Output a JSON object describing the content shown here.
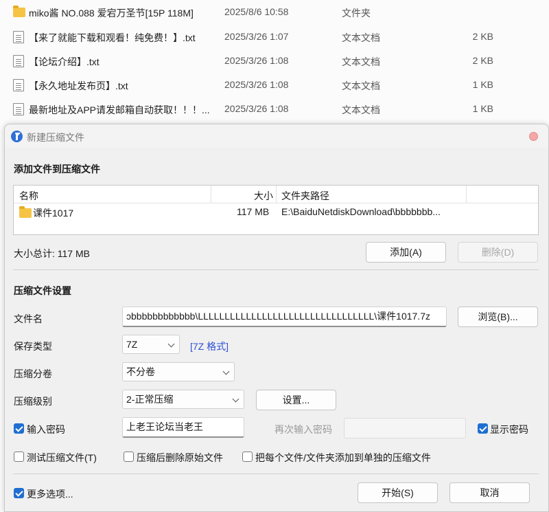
{
  "explorer": {
    "rows": [
      {
        "icon": "folder-icon",
        "name": "miko酱 NO.088 爱宕万圣节[15P 118M]",
        "date": "2025/8/6 10:58",
        "type": "文件夹",
        "size": ""
      },
      {
        "icon": "text-file-icon",
        "name": "【来了就能下载和观看！纯免费！】.txt",
        "date": "2025/3/26 1:07",
        "type": "文本文档",
        "size": "2 KB"
      },
      {
        "icon": "text-file-icon",
        "name": "【论坛介绍】.txt",
        "date": "2025/3/26 1:08",
        "type": "文本文档",
        "size": "2 KB"
      },
      {
        "icon": "text-file-icon",
        "name": "【永久地址发布页】.txt",
        "date": "2025/3/26 1:08",
        "type": "文本文档",
        "size": "1 KB"
      },
      {
        "icon": "text-file-icon",
        "name": "最新地址及APP请发邮箱自动获取！！！...",
        "date": "2025/3/26 1:08",
        "type": "文本文档",
        "size": "1 KB"
      }
    ]
  },
  "dialog": {
    "title": "新建压缩文件",
    "add_section_title": "添加文件到压缩文件",
    "file_list": {
      "headers": {
        "name": "名称",
        "size": "大小",
        "path": "文件夹路径"
      },
      "rows": [
        {
          "name": "课件1017",
          "size": "117 MB",
          "path": "E:\\BaiduNetdiskDownload\\bbbbbbb..."
        }
      ]
    },
    "total_size": "大小总计: 117 MB",
    "add_button": "添加(A)",
    "delete_button": "删除(D)",
    "settings_section_title": "压缩文件设置",
    "filename_label": "文件名",
    "filename_value": "ɔbbbbbbbbbbbb\\LLLLLLLLLLLLLLLLLLLLLLLLLLLLLLLLL\\课件1017.7z",
    "browse_button": "浏览(B)...",
    "save_type_label": "保存类型",
    "save_type_value": "7Z",
    "format_link": "[7Z 格式]",
    "split_label": "压缩分卷",
    "split_value": "不分卷",
    "level_label": "压缩级别",
    "level_value": "2-正常压缩",
    "settings_button": "设置...",
    "password_checkbox_label": "输入密码",
    "password_checked": true,
    "password_value": "上老王论坛当老王",
    "repeat_password_label": "再次输入密码",
    "repeat_password_value": "",
    "show_password_label": "显示密码",
    "show_password_checked": true,
    "test_label": "测试压缩文件(T)",
    "test_checked": false,
    "delete_original_label": "压缩后删除原始文件",
    "delete_original_checked": false,
    "separate_label": "把每个文件/文件夹添加到单独的压缩文件",
    "separate_checked": false,
    "more_options_label": "更多选项...",
    "more_options_checked": true,
    "start_button": "开始(S)",
    "cancel_button": "取消"
  }
}
